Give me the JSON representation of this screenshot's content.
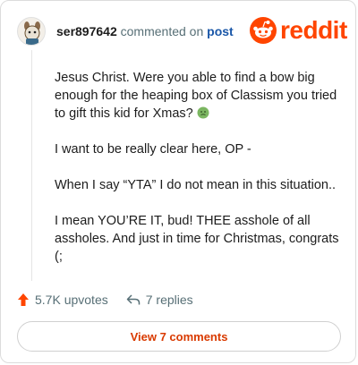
{
  "header": {
    "username": "ser897642",
    "action_text": "commented on",
    "post_link": "post"
  },
  "brand": {
    "name": "reddit",
    "icon": "reddit-snoo-icon",
    "color": "#ff4500"
  },
  "comment": {
    "paragraphs": [
      "Jesus Christ. Were you able to find a bow big enough for the heaping box of Classism you tried to gift this kid for Xmas?",
      "I want to be really clear here, OP -",
      "When I say “YTA” I do not mean in this situation..",
      "I mean YOU’RE IT, bud! THEE asshole of all assholes. And just in time for Christmas, congrats (;"
    ],
    "emoji": "nauseated-face-icon"
  },
  "footer": {
    "upvotes": "5.7K upvotes",
    "upvote_icon": "upvote-arrow-icon",
    "upvote_color": "#ff4500",
    "replies": "7 replies",
    "reply_icon": "reply-arrow-icon"
  },
  "view_button": {
    "label": "View 7 comments",
    "color": "#d93a00"
  }
}
